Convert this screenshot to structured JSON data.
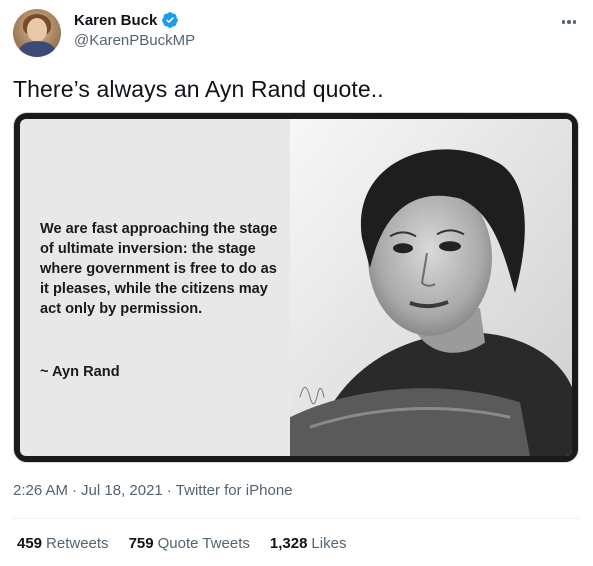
{
  "tweet": {
    "display_name": "Karen Buck",
    "handle": "@KarenPBuckMP",
    "verified_icon": "verified-badge-icon",
    "more_icon": "more-options-icon",
    "text": "There’s always an Ayn Rand quote..",
    "media": {
      "quote": "We are fast approaching the stage of ultimate inversion: the stage where government is free to do as it pleases, while the citizens may act only by permission.",
      "author": "~ Ayn Rand"
    },
    "time": "2:26 AM",
    "date": "Jul 18, 2021",
    "separator": "·",
    "source": "Twitter for iPhone",
    "stats": {
      "retweets_count": "459",
      "retweets_label": "Retweets",
      "quotes_count": "759",
      "quotes_label": "Quote Tweets",
      "likes_count": "1,328",
      "likes_label": "Likes"
    }
  },
  "colors": {
    "text_primary": "#0f1419",
    "text_secondary": "#536471",
    "verified": "#1d9bf0",
    "divider": "#eff3f4"
  }
}
